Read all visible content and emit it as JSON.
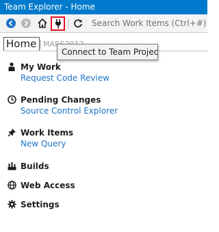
{
  "window": {
    "title": "Team Explorer - Home"
  },
  "toolbar": {
    "back_icon": "back-arrow-icon",
    "forward_icon": "forward-arrow-icon",
    "home_icon": "home-icon",
    "connect_icon": "plug-icon",
    "refresh_icon": "refresh-icon",
    "search_placeholder": "Search Work Items (Ctrl+#)",
    "accent_color": "#007acc",
    "highlight_color": "#e81123"
  },
  "header": {
    "title": "Home",
    "separator": "|",
    "project": "MARS2012"
  },
  "tooltip": {
    "text": "Connect to Team Projects"
  },
  "sections": {
    "my_work": {
      "title": "My Work",
      "link": "Request Code Review",
      "icon": "person-icon"
    },
    "pending_changes": {
      "title": "Pending Changes",
      "link": "Source Control Explorer",
      "icon": "clock-icon"
    },
    "work_items": {
      "title": "Work Items",
      "link": "New Query",
      "icon": "pin-icon"
    },
    "builds": {
      "title": "Builds",
      "icon": "builds-icon"
    },
    "web_access": {
      "title": "Web Access",
      "icon": "globe-icon"
    },
    "settings": {
      "title": "Settings",
      "icon": "gear-icon"
    }
  }
}
